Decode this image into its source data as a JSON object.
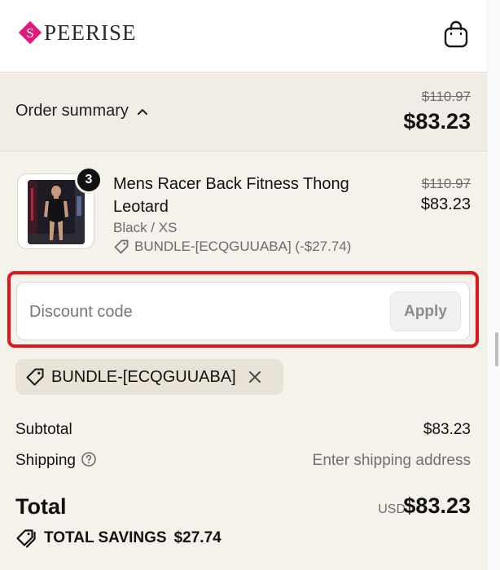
{
  "brand": {
    "logo_text": "PEERISE",
    "logo_letter": "S",
    "accent": "#e01a7c"
  },
  "header": {
    "cart_icon": "shopping-bag-icon"
  },
  "summary": {
    "toggle_label": "Order summary",
    "original_total": "$110.97",
    "total": "$83.23"
  },
  "line_item": {
    "quantity": "3",
    "name": "Mens Racer Back Fitness Thong Leotard",
    "variant": "Black / XS",
    "discount_tag": "BUNDLE-[ECQGUUABA] (-$27.74)",
    "original_price": "$110.97",
    "price": "$83.23"
  },
  "discount": {
    "placeholder": "Discount code",
    "apply_label": "Apply",
    "highlight_color": "#e1141b"
  },
  "applied_code": {
    "label": "BUNDLE-[ECQGUUABA]"
  },
  "totals": {
    "subtotal_label": "Subtotal",
    "subtotal_value": "$83.23",
    "shipping_label": "Shipping",
    "shipping_value": "Enter shipping address",
    "total_label": "Total",
    "currency": "USD",
    "total_value": "$83.23",
    "savings_label": "TOTAL SAVINGS",
    "savings_value": "$27.74"
  }
}
